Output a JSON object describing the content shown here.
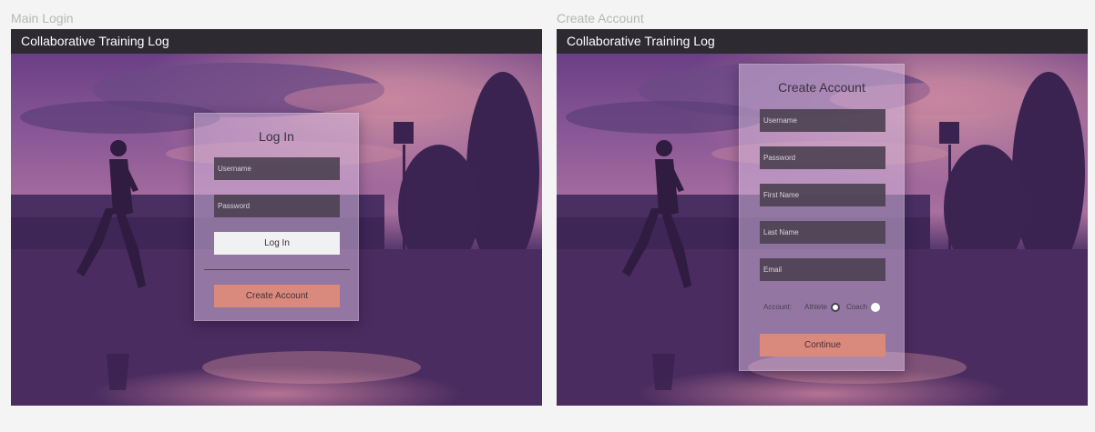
{
  "frames": [
    {
      "label": "Main Login",
      "app_title": "Collaborative Training Log",
      "panel_title": "Log In",
      "username_placeholder": "Username",
      "password_placeholder": "Password",
      "login_label": "Log In",
      "create_account_label": "Create Account"
    },
    {
      "label": "Create Account",
      "app_title": "Collaborative Training Log",
      "panel_title": "Create Account",
      "username_placeholder": "Username",
      "password_placeholder": "Password",
      "first_name_placeholder": "First Name",
      "last_name_placeholder": "Last Name",
      "email_placeholder": "Email",
      "account_label": "Account:",
      "account_options": [
        "Athlete",
        "Coach"
      ],
      "selected_account": "Athlete",
      "continue_label": "Continue"
    }
  ],
  "colors": {
    "titlebar": "#2e2a31",
    "field_bg": "#4e4254",
    "salmon_button": "#d98a7c",
    "white_button": "#f1f0f2"
  }
}
